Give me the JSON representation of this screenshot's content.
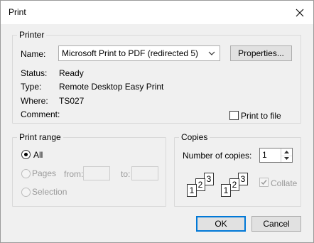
{
  "dialog": {
    "title": "Print"
  },
  "printer": {
    "group_label": "Printer",
    "name_label": "Name:",
    "name_value": "Microsoft Print to PDF (redirected 5)",
    "properties_button": "Properties...",
    "status_label": "Status:",
    "status_value": "Ready",
    "type_label": "Type:",
    "type_value": "Remote Desktop Easy Print",
    "where_label": "Where:",
    "where_value": "TS027",
    "comment_label": "Comment:",
    "print_to_file_label": "Print to file",
    "print_to_file_checked": false
  },
  "print_range": {
    "group_label": "Print range",
    "all_label": "All",
    "pages_label": "Pages",
    "from_label": "from:",
    "to_label": "to:",
    "selection_label": "Selection",
    "selected": "All"
  },
  "copies": {
    "group_label": "Copies",
    "number_label": "Number of copies:",
    "number_value": "1",
    "collate_label": "Collate",
    "collate_checked": true,
    "page_numbers": [
      "1",
      "2",
      "3"
    ]
  },
  "buttons": {
    "ok": "OK",
    "cancel": "Cancel"
  },
  "colors": {
    "accent": "#0078d7",
    "dialog_bg": "#f0f0f0",
    "disabled_text": "#9a9a9a"
  }
}
